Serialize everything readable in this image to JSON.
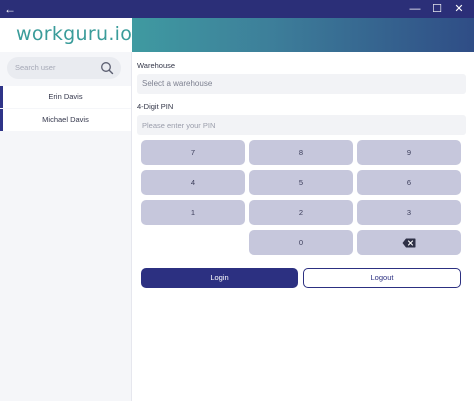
{
  "titlebar": {
    "back_icon": "←",
    "minimize_icon": "—",
    "maximize_icon": "☐",
    "close_icon": "✕"
  },
  "brand": {
    "logo_text": "workguru.io",
    "color": "#3a9c9a"
  },
  "search": {
    "placeholder": "Search user",
    "icon": "search-icon"
  },
  "users": [
    {
      "name": "Erin Davis"
    },
    {
      "name": "Michael Davis"
    }
  ],
  "form": {
    "warehouse_label": "Warehouse",
    "warehouse_value": "Select a warehouse",
    "pin_label": "4-Digit PIN",
    "pin_placeholder": "Please enter your PIN"
  },
  "keypad": {
    "keys": [
      "7",
      "8",
      "9",
      "4",
      "5",
      "6",
      "1",
      "2",
      "3",
      "0"
    ],
    "backspace_icon": "backspace-icon"
  },
  "actions": {
    "login_label": "Login",
    "logout_label": "Logout"
  },
  "colors": {
    "primary": "#2c3081",
    "key_bg": "#c6c7dc",
    "teal": "#3f9aa1"
  }
}
